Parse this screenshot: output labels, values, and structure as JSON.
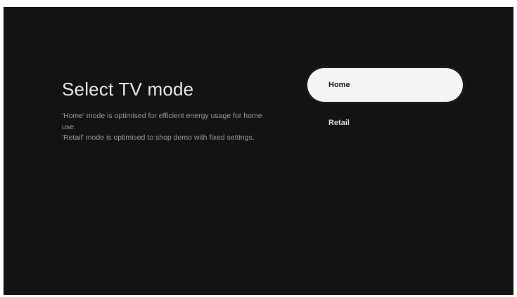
{
  "screen": {
    "title": "Select TV mode",
    "description": [
      "'Home' mode is optimised for efficient energy usage for home use.",
      "'Retail' mode is optimised to shop demo with fixed settings."
    ]
  },
  "options": [
    {
      "label": "Home",
      "selected": true
    },
    {
      "label": "Retail",
      "selected": false
    }
  ],
  "colors": {
    "background": "#131312",
    "selected_option": "#f4f4f4",
    "title_text": "#e6e6e6",
    "description_text": "#9a9a9a"
  }
}
